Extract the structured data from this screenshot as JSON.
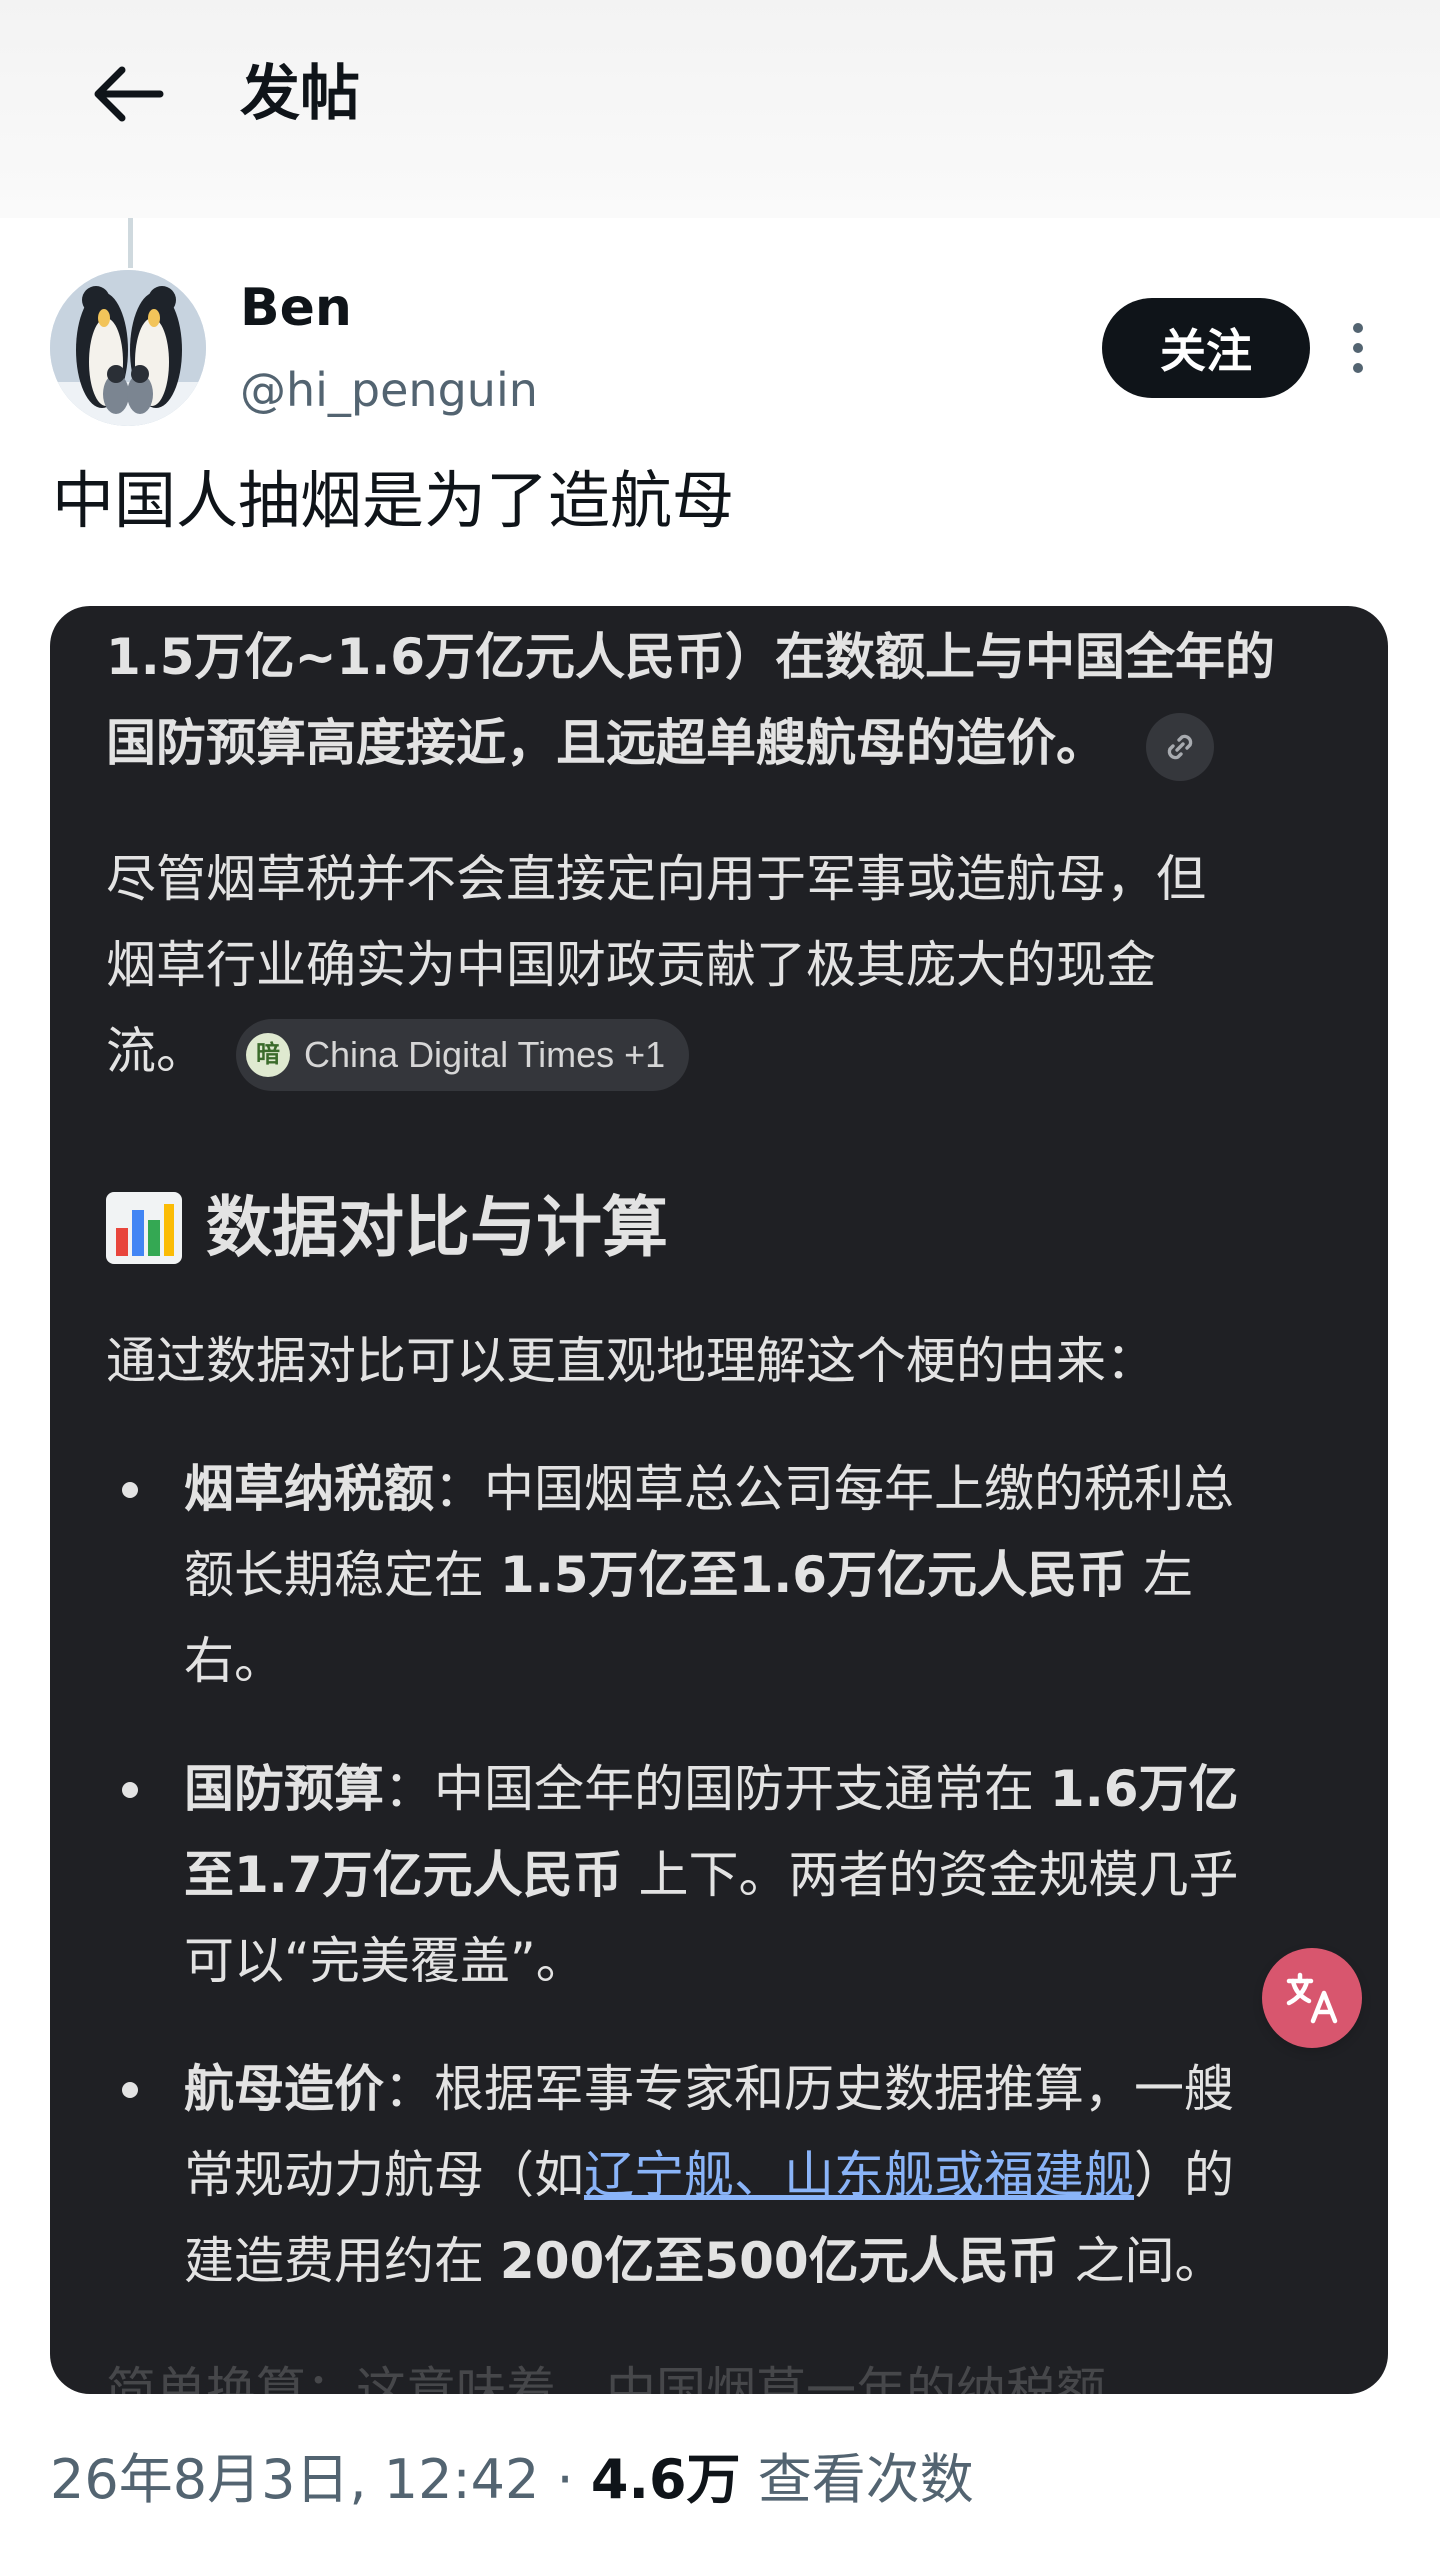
{
  "header": {
    "title": "发帖"
  },
  "author": {
    "name": "Ben",
    "handle": "@hi_penguin",
    "follow_label": "关注"
  },
  "post": {
    "text": "中国人抽烟是为了造航母"
  },
  "card": {
    "para1": {
      "line1": "1.5万亿~1.6万亿元人民币）在数额上与中国全年的",
      "line2": "国防预算高度接近，且远超单艘航母的造价。"
    },
    "para2": {
      "line1": "尽管烟草税并不会直接定向用于军事或造航母，但",
      "line2": "烟草行业确实为中国财政贡献了极其庞大的现金",
      "line3": "流。",
      "source_chip": "China Digital Times +1",
      "source_chip_badge": "暗"
    },
    "section_heading": "数据对比与计算",
    "intro": "通过数据对比可以更直观地理解这个梗的由来：",
    "bullets": [
      {
        "term": "烟草纳税额",
        "sep": "：",
        "l1": "中国烟草总公司每年上缴的税利总",
        "l2a": "额长期稳定在 ",
        "l2b": "1.5万亿至1.6万亿元人民币",
        "l2c": " 左",
        "l3": "右。"
      },
      {
        "term": "国防预算",
        "sep": "：",
        "l1a": "中国全年的国防开支通常在 ",
        "l1b": "1.6万亿",
        "l2a": "至1.7万亿元人民币",
        "l2b": " 上下。两者的资金规模几乎",
        "l3": "可以“完美覆盖”。"
      },
      {
        "term": "航母造价",
        "sep": "：",
        "l1": "根据军事专家和历史数据推算，一艘",
        "l2a": "常规动力航母（如",
        "l2link": "辽宁舰、山东舰或福建舰",
        "l2b": "）的",
        "l3a": "建造费用约在 ",
        "l3b": "200亿至500亿元人民币",
        "l3c": " 之间。"
      }
    ],
    "faded_line": "简单换算：这意味着，中国烟草一年的纳税额"
  },
  "meta": {
    "date": "26年8月3日, 12:42",
    "separator": "·",
    "views_count": "4.6万",
    "views_label": "查看次数"
  }
}
